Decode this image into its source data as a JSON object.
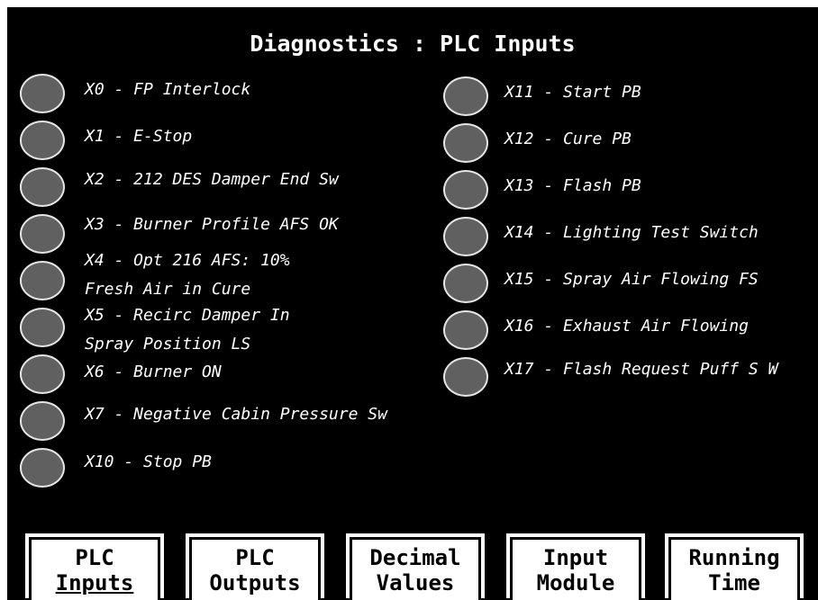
{
  "screen": {
    "title": "Diagnostics : PLC Inputs"
  },
  "left_inputs": [
    {
      "line1": "X0 - FP Interlock",
      "line2": ""
    },
    {
      "line1": "X1 - E-Stop",
      "line2": ""
    },
    {
      "line1": "X2 - 212 DES Damper End Sw",
      "line2": ""
    },
    {
      "line1": "X3 - Burner Profile AFS OK",
      "line2": ""
    },
    {
      "line1": "X4 - Opt 216 AFS: 10%",
      "line2": "Fresh Air in Cure"
    },
    {
      "line1": "X5 - Recirc Damper In",
      "line2": "Spray Position LS"
    },
    {
      "line1": "X6 - Burner ON",
      "line2": ""
    },
    {
      "line1": "X7 - Negative Cabin Pressure Sw",
      "line2": ""
    },
    {
      "line1": "X10 - Stop PB",
      "line2": ""
    }
  ],
  "right_inputs": [
    {
      "line1": "X11 - Start PB"
    },
    {
      "line1": "X12 - Cure PB"
    },
    {
      "line1": "X13 - Flash PB"
    },
    {
      "line1": "X14 - Lighting Test Switch"
    },
    {
      "line1": "X15 - Spray Air Flowing FS"
    },
    {
      "line1": "X16 - Exhaust Air Flowing"
    },
    {
      "line1": "X17 - Flash Request Puff S W"
    }
  ],
  "softkeys": [
    {
      "line1": "PLC",
      "line2": "Inputs"
    },
    {
      "line1": "PLC",
      "line2": "Outputs"
    },
    {
      "line1": "Decimal",
      "line2": "Values"
    },
    {
      "line1": "Input",
      "line2": "Module"
    },
    {
      "line1": "Running",
      "line2": "Time"
    }
  ],
  "colors": {
    "background": "#000000",
    "led_off": "#606060",
    "text": "#ffffff",
    "softkey_bg": "#ffffff"
  }
}
